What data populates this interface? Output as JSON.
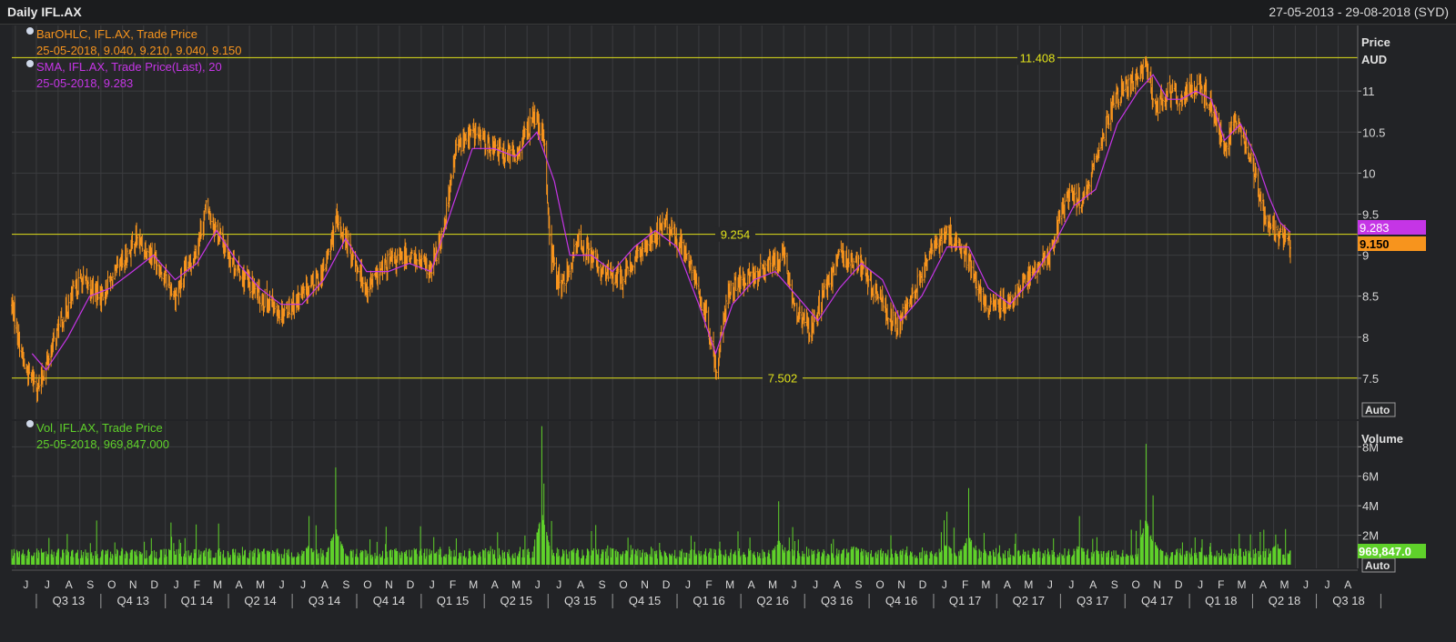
{
  "header": {
    "title": "Daily IFL.AX",
    "date_range": "27-05-2013 - 29-08-2018 (SYD)"
  },
  "legend": {
    "bar_label": "BarOHLC, IFL.AX, Trade Price",
    "bar_values": "25-05-2018, 9.040, 9.210, 9.040, 9.150",
    "sma_label": "SMA, IFL.AX, Trade Price(Last),  20",
    "sma_values": "25-05-2018, 9.283",
    "vol_label": "Vol, IFL.AX, Trade Price",
    "vol_values": "25-05-2018, 969,847.000"
  },
  "axis": {
    "price_title": "Price",
    "price_unit": "AUD",
    "volume_title": "Volume",
    "auto_label": "Auto",
    "auto_label_vol": "Auto"
  },
  "last": {
    "sma": "9.283",
    "close": "9.150",
    "volume": "969,847.0"
  },
  "lines": {
    "high": "11.408",
    "mid": "9.254",
    "low": "7.502"
  },
  "colors": {
    "ohlc": "#f7941d",
    "sma": "#c535e6",
    "volume": "#5fd12a",
    "hline": "#e1e21a",
    "grid": "#3b3c3f",
    "axis_text": "#d8d8d8"
  },
  "chart_data": [
    {
      "type": "line",
      "title": "Daily IFL.AX",
      "xlabel": "",
      "ylabel": "Price AUD",
      "xlim": [
        "2013-05-27",
        "2018-08-29"
      ],
      "ylim": [
        7.0,
        11.8
      ],
      "yticks": [
        7.5,
        8,
        8.5,
        9,
        9.5,
        10,
        10.5,
        11
      ],
      "ytick_labels": [
        "7.5",
        "8",
        "8.5",
        "9",
        "9.5",
        "10",
        "10.5",
        "11"
      ],
      "horizontal_lines": [
        11.408,
        9.254,
        7.502
      ],
      "month_labels": [
        "J",
        "J",
        "A",
        "S",
        "O",
        "N",
        "D",
        "J",
        "F",
        "M",
        "A",
        "M",
        "J",
        "J",
        "A",
        "S",
        "O",
        "N",
        "D",
        "J",
        "F",
        "M",
        "A",
        "M",
        "J",
        "J",
        "A",
        "S",
        "O",
        "N",
        "D",
        "J",
        "F",
        "M",
        "A",
        "M",
        "J",
        "J",
        "A",
        "S",
        "O",
        "N",
        "D",
        "J",
        "F",
        "M",
        "A",
        "M",
        "J",
        "J",
        "A",
        "S",
        "O",
        "N",
        "D",
        "J",
        "F",
        "M",
        "A",
        "M",
        "J",
        "J",
        "A"
      ],
      "quarter_labels": [
        "Q3 13",
        "Q4 13",
        "Q1 14",
        "Q2 14",
        "Q3 14",
        "Q4 14",
        "Q1 15",
        "Q2 15",
        "Q3 15",
        "Q4 15",
        "Q1 16",
        "Q2 16",
        "Q3 16",
        "Q4 16",
        "Q1 17",
        "Q2 17",
        "Q3 17",
        "Q4 17",
        "Q1 18",
        "Q2 18",
        "Q3 18"
      ],
      "series": [
        {
          "name": "BarOHLC, IFL.AX, Trade Price",
          "x": [
            "2013-05-27",
            "2013-06-15",
            "2013-07-05",
            "2013-08-01",
            "2013-09-01",
            "2013-10-01",
            "2013-11-01",
            "2013-11-20",
            "2013-12-15",
            "2014-01-15",
            "2014-02-15",
            "2014-03-01",
            "2014-03-15",
            "2014-04-15",
            "2014-05-15",
            "2014-06-15",
            "2014-07-15",
            "2014-08-15",
            "2014-09-01",
            "2014-09-15",
            "2014-10-15",
            "2014-11-15",
            "2014-12-15",
            "2015-01-15",
            "2015-02-01",
            "2015-02-20",
            "2015-03-15",
            "2015-04-15",
            "2015-05-15",
            "2015-06-10",
            "2015-06-25",
            "2015-07-05",
            "2015-07-20",
            "2015-08-15",
            "2015-09-15",
            "2015-10-15",
            "2015-11-15",
            "2015-12-15",
            "2016-01-15",
            "2016-02-10",
            "2016-02-25",
            "2016-03-15",
            "2016-04-15",
            "2016-05-15",
            "2016-06-01",
            "2016-06-20",
            "2016-07-10",
            "2016-08-01",
            "2016-08-20",
            "2016-09-15",
            "2016-10-15",
            "2016-11-10",
            "2016-12-01",
            "2017-01-01",
            "2017-01-20",
            "2017-02-15",
            "2017-03-15",
            "2017-04-15",
            "2017-05-15",
            "2017-06-15",
            "2017-07-01",
            "2017-07-15",
            "2017-08-01",
            "2017-08-15",
            "2017-09-15",
            "2017-10-15",
            "2017-10-31",
            "2017-11-15",
            "2017-12-01",
            "2017-12-20",
            "2018-01-15",
            "2018-02-01",
            "2018-02-20",
            "2018-03-10",
            "2018-04-01",
            "2018-04-20",
            "2018-05-10",
            "2018-05-25"
          ],
          "values": [
            8.4,
            7.6,
            7.4,
            8.1,
            8.7,
            8.5,
            8.9,
            9.2,
            9.0,
            8.5,
            9.1,
            9.6,
            9.3,
            8.8,
            8.5,
            8.3,
            8.5,
            8.8,
            9.4,
            9.2,
            8.6,
            8.9,
            9.0,
            8.8,
            9.3,
            10.3,
            10.5,
            10.3,
            10.2,
            10.7,
            10.4,
            9.0,
            8.6,
            9.2,
            8.8,
            8.7,
            9.1,
            9.4,
            9.0,
            8.3,
            7.6,
            8.6,
            8.7,
            8.9,
            9.0,
            8.3,
            8.1,
            8.6,
            9.0,
            8.9,
            8.5,
            8.1,
            8.5,
            9.1,
            9.3,
            9.0,
            8.4,
            8.4,
            8.7,
            9.0,
            9.5,
            9.8,
            9.6,
            10.0,
            10.9,
            11.1,
            11.3,
            10.8,
            11.0,
            10.9,
            11.1,
            10.8,
            10.3,
            10.7,
            10.1,
            9.4,
            9.2,
            9.15
          ]
        },
        {
          "name": "SMA, IFL.AX, Trade Price(Last),  20",
          "x": [
            "2013-06-25",
            "2013-07-15",
            "2013-08-15",
            "2013-09-15",
            "2013-10-15",
            "2013-11-15",
            "2013-12-15",
            "2014-01-15",
            "2014-02-15",
            "2014-03-15",
            "2014-04-15",
            "2014-05-15",
            "2014-06-15",
            "2014-07-15",
            "2014-08-15",
            "2014-09-15",
            "2014-10-15",
            "2014-11-15",
            "2014-12-15",
            "2015-01-15",
            "2015-02-15",
            "2015-03-15",
            "2015-04-15",
            "2015-05-15",
            "2015-06-15",
            "2015-07-10",
            "2015-08-01",
            "2015-09-01",
            "2015-10-01",
            "2015-11-01",
            "2015-12-01",
            "2016-01-01",
            "2016-02-01",
            "2016-02-25",
            "2016-03-20",
            "2016-04-20",
            "2016-05-20",
            "2016-06-20",
            "2016-07-20",
            "2016-08-20",
            "2016-09-20",
            "2016-10-20",
            "2016-11-15",
            "2016-12-15",
            "2017-01-20",
            "2017-02-20",
            "2017-03-20",
            "2017-04-20",
            "2017-05-20",
            "2017-06-20",
            "2017-07-20",
            "2017-08-20",
            "2017-09-20",
            "2017-10-20",
            "2017-11-10",
            "2017-12-01",
            "2017-12-20",
            "2018-01-10",
            "2018-02-01",
            "2018-02-20",
            "2018-03-15",
            "2018-04-05",
            "2018-04-25",
            "2018-05-10",
            "2018-05-25"
          ],
          "values": [
            7.8,
            7.6,
            8.0,
            8.5,
            8.6,
            8.8,
            9.0,
            8.7,
            8.9,
            9.3,
            8.9,
            8.6,
            8.4,
            8.4,
            8.7,
            9.2,
            8.8,
            8.8,
            8.9,
            8.8,
            9.6,
            10.3,
            10.3,
            10.2,
            10.5,
            9.9,
            9.0,
            9.0,
            8.8,
            9.1,
            9.3,
            9.1,
            8.4,
            7.8,
            8.4,
            8.7,
            8.8,
            8.5,
            8.2,
            8.6,
            8.9,
            8.7,
            8.2,
            8.5,
            9.1,
            9.1,
            8.6,
            8.4,
            8.7,
            9.1,
            9.6,
            9.8,
            10.6,
            11.0,
            11.2,
            10.9,
            10.9,
            11.0,
            10.9,
            10.4,
            10.6,
            10.2,
            9.7,
            9.4,
            9.28
          ]
        }
      ]
    },
    {
      "type": "bar",
      "title": "Vol, IFL.AX, Trade Price",
      "ylabel": "Volume",
      "ylim": [
        0,
        9500000
      ],
      "yticks": [
        2000000,
        4000000,
        6000000,
        8000000
      ],
      "ytick_labels": [
        "2M",
        "4M",
        "6M",
        "8M"
      ],
      "series": [
        {
          "name": "Vol, IFL.AX, Trade Price",
          "peaks": [
            {
              "x": "2013-09-25",
              "value": 3000000
            },
            {
              "x": "2014-07-25",
              "value": 3300000
            },
            {
              "x": "2014-09-01",
              "value": 6600000
            },
            {
              "x": "2015-06-22",
              "value": 9400000
            },
            {
              "x": "2015-06-25",
              "value": 5500000
            },
            {
              "x": "2016-05-25",
              "value": 4300000
            },
            {
              "x": "2016-09-10",
              "value": 3400000
            },
            {
              "x": "2017-01-20",
              "value": 3600000
            },
            {
              "x": "2017-02-20",
              "value": 5200000
            },
            {
              "x": "2017-07-28",
              "value": 3300000
            },
            {
              "x": "2017-10-31",
              "value": 8200000
            },
            {
              "x": "2017-11-10",
              "value": 4700000
            },
            {
              "x": "2018-05-05",
              "value": 3800000
            },
            {
              "x": "2018-05-25",
              "value": 969847
            }
          ],
          "typical": 800000
        }
      ]
    }
  ]
}
